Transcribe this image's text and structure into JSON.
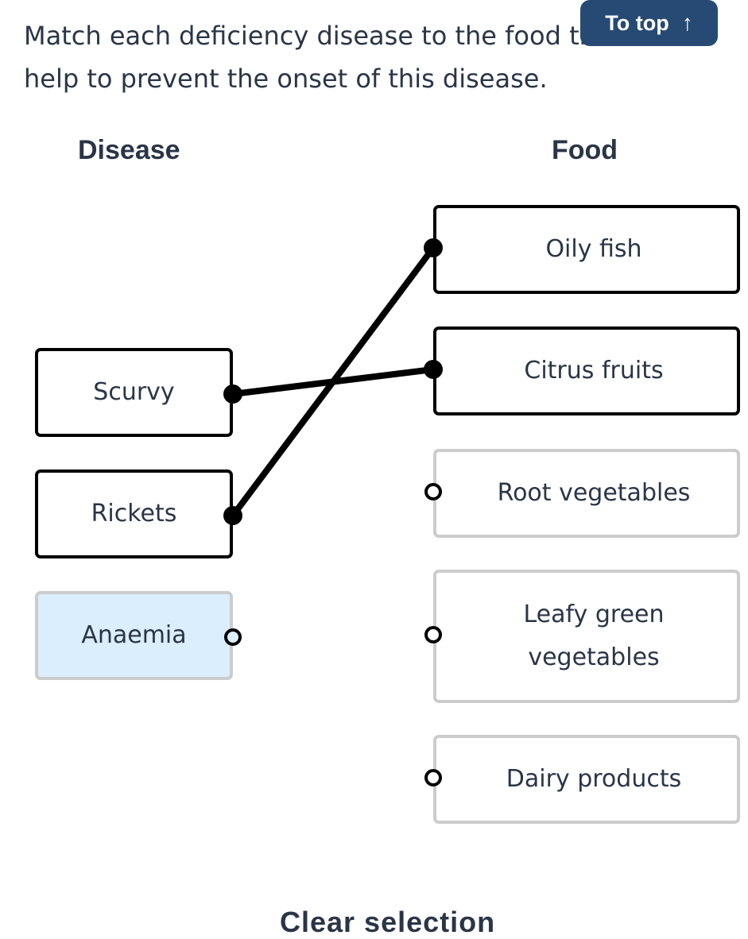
{
  "question": "Match each deficiency disease to the food that can help to prevent the onset of this disease.",
  "to_top": {
    "label": "To top",
    "icon": "arrow-up-icon",
    "icon_glyph": "↑"
  },
  "columns": {
    "disease_header": "Disease",
    "food_header": "Food"
  },
  "diseases": [
    {
      "id": "scurvy",
      "label": "Scurvy",
      "state": "matched"
    },
    {
      "id": "rickets",
      "label": "Rickets",
      "state": "matched"
    },
    {
      "id": "anaemia",
      "label": "Anaemia",
      "state": "selected"
    }
  ],
  "foods": [
    {
      "id": "oily-fish",
      "label": "Oily fish",
      "state": "matched"
    },
    {
      "id": "citrus-fruits",
      "label": "Citrus fruits",
      "state": "matched"
    },
    {
      "id": "root-vegetables",
      "label": "Root vegetables",
      "state": "unmatched"
    },
    {
      "id": "leafy-green-vegetables",
      "label": "Leafy green vegetables",
      "state": "unmatched"
    },
    {
      "id": "dairy-products",
      "label": "Dairy products",
      "state": "unmatched"
    }
  ],
  "matches": [
    {
      "disease": "scurvy",
      "food": "citrus-fruits"
    },
    {
      "disease": "rickets",
      "food": "oily-fish"
    }
  ],
  "clear_selection_label": "Clear selection",
  "colors": {
    "text": "#2a3547",
    "button_bg": "#264a74",
    "selected_bg": "#dbeefd",
    "matched_border": "#000000",
    "unmatched_border": "#cccccc",
    "connector": "#000000"
  }
}
